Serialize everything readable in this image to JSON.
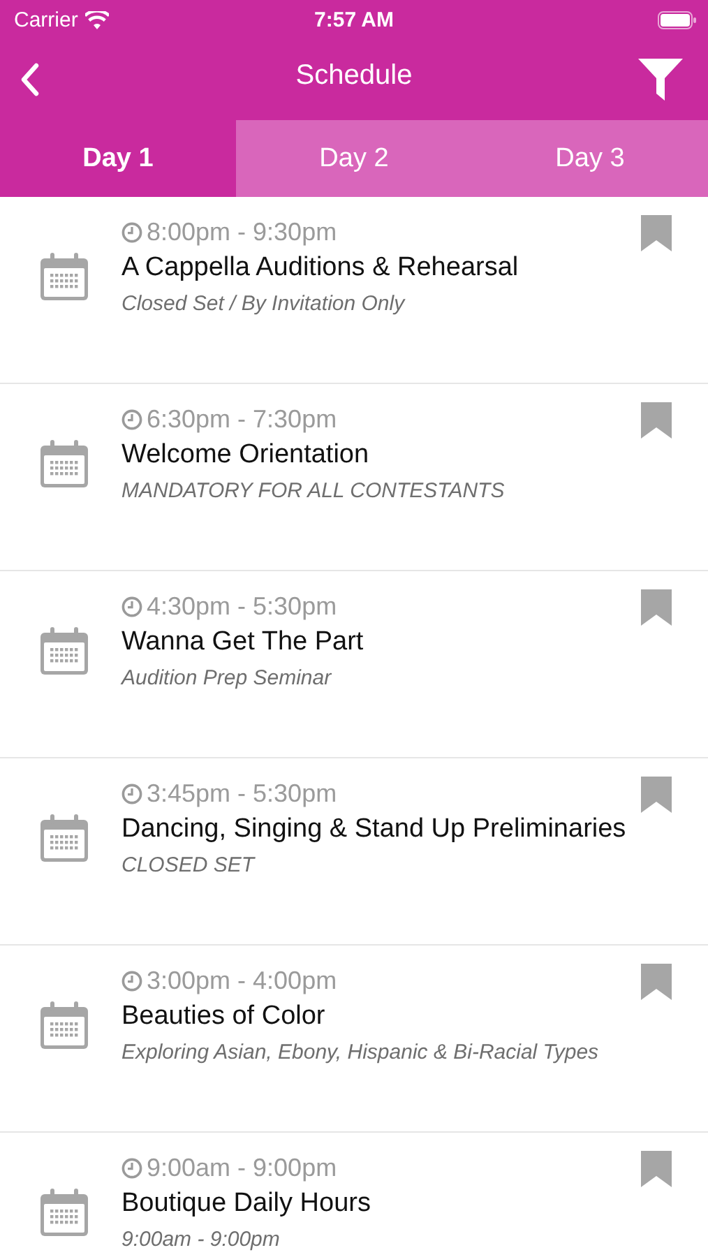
{
  "status_bar": {
    "carrier": "Carrier",
    "time": "7:57 AM"
  },
  "nav": {
    "title": "Schedule"
  },
  "tabs": [
    {
      "label": "Day 1",
      "selected": true
    },
    {
      "label": "Day 2",
      "selected": false
    },
    {
      "label": "Day 3",
      "selected": false
    }
  ],
  "events": [
    {
      "time": "8:00pm - 9:30pm",
      "title": "A Cappella Auditions & Rehearsal",
      "subtitle": "Closed Set / By Invitation Only",
      "bookmarked": false
    },
    {
      "time": "6:30pm - 7:30pm",
      "title": "Welcome Orientation",
      "subtitle": "MANDATORY FOR ALL CONTESTANTS",
      "bookmarked": false
    },
    {
      "time": "4:30pm - 5:30pm",
      "title": "Wanna Get The Part",
      "subtitle": "Audition Prep Seminar",
      "bookmarked": false
    },
    {
      "time": "3:45pm - 5:30pm",
      "title": "Dancing, Singing & Stand Up Preliminaries",
      "subtitle": "CLOSED SET",
      "bookmarked": false
    },
    {
      "time": "3:00pm - 4:00pm",
      "title": "Beauties of Color",
      "subtitle": "Exploring Asian, Ebony, Hispanic & Bi-Racial Types",
      "bookmarked": false
    },
    {
      "time": "9:00am - 9:00pm",
      "title": "Boutique Daily Hours",
      "subtitle": "9:00am - 9:00pm",
      "bookmarked": false
    }
  ]
}
